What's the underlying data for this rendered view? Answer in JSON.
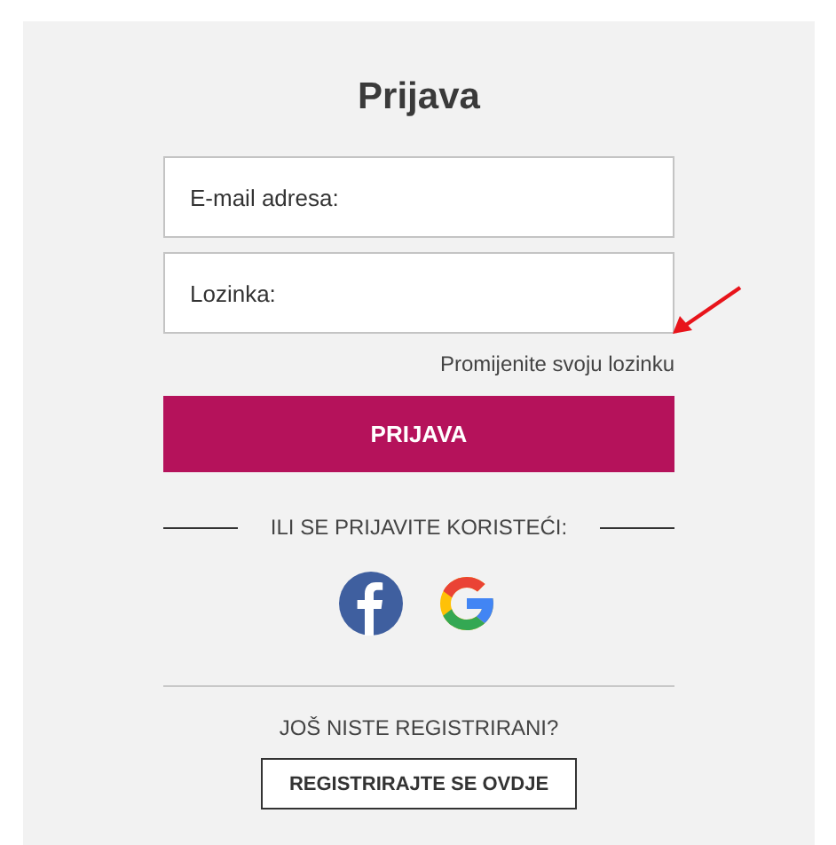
{
  "title": "Prijava",
  "fields": [
    {
      "placeholder": "E-mail adresa:"
    },
    {
      "placeholder": "Lozinka:"
    }
  ],
  "forgot_link": "Promijenite svoju lozinku",
  "submit_button": "PRIJAVA",
  "social_divider": "ILI SE PRIJAVITE KORISTEĆI:",
  "social_buttons": [
    {
      "kind": "facebook"
    },
    {
      "kind": "google"
    }
  ],
  "register_prompt": "JOŠ NISTE REGISTRIRANI?",
  "register_button": "REGISTRIRAJTE SE OVDJE"
}
